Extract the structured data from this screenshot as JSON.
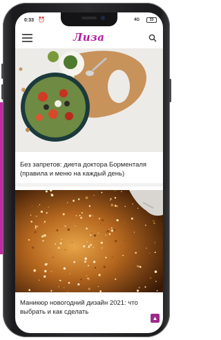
{
  "status_bar": {
    "time": "0:33",
    "alarm_icon": "alarm-clock-icon",
    "signal": "4G",
    "battery": "33"
  },
  "header": {
    "logo": "Лиза",
    "menu_icon": "hamburger-icon",
    "search_icon": "search-icon"
  },
  "articles": [
    {
      "title": "Без запретов: диета доктора Борменталя (правила и меню на каждый день)",
      "image": "food-salad-bowl-image"
    },
    {
      "title": "Маникюр новогодний дизайн 2021: что выбрать и как сделать",
      "image": "golden-glitter-image"
    }
  ],
  "scroll_top_icon": "chevron-up-icon",
  "colors": {
    "brand": "#b5179e",
    "scroll_button": "#9c2a8c"
  }
}
